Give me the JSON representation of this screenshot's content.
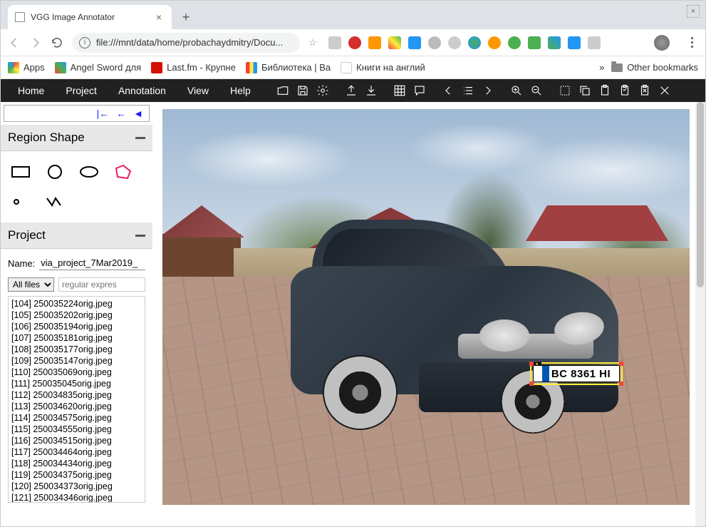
{
  "browser": {
    "tab_title": "VGG Image Annotator",
    "url": "file:///mnt/data/home/probachaydmitry/Docu...",
    "bookmarks": [
      {
        "label": "Apps",
        "color": "grid"
      },
      {
        "label": "Angel Sword для",
        "color": "multi"
      },
      {
        "label": "Last.fm - Крупне",
        "color": "#d51007"
      },
      {
        "label": "Библиотека | Ва",
        "color": "multi2"
      },
      {
        "label": "Книги на англий",
        "color": "book"
      }
    ],
    "bookmarks_more": "»",
    "other_bookmarks": "Other bookmarks"
  },
  "menus": [
    "Home",
    "Project",
    "Annotation",
    "View",
    "Help"
  ],
  "panels": {
    "region_shape": "Region Shape",
    "project": "Project"
  },
  "project": {
    "name_label": "Name:",
    "name_value": "via_project_7Mar2019_",
    "filter_select": "All files",
    "filter_placeholder": "regular expres"
  },
  "files": [
    "[104] 250035224orig.jpeg",
    "[105] 250035202orig.jpeg",
    "[106] 250035194orig.jpeg",
    "[107] 250035181orig.jpeg",
    "[108] 250035177orig.jpeg",
    "[109] 250035147orig.jpeg",
    "[110] 250035069orig.jpeg",
    "[111] 250035045orig.jpeg",
    "[112] 250034835orig.jpeg",
    "[113] 250034620orig.jpeg",
    "[114] 250034575orig.jpeg",
    "[115] 250034555orig.jpeg",
    "[116] 250034515orig.jpeg",
    "[117] 250034464orig.jpeg",
    "[118] 250034434orig.jpeg",
    "[119] 250034375orig.jpeg",
    "[120] 250034373orig.jpeg",
    "[121] 250034346orig.jpeg"
  ],
  "annotation": {
    "region_id": "1",
    "plate_text": "BC 8361 HI"
  }
}
